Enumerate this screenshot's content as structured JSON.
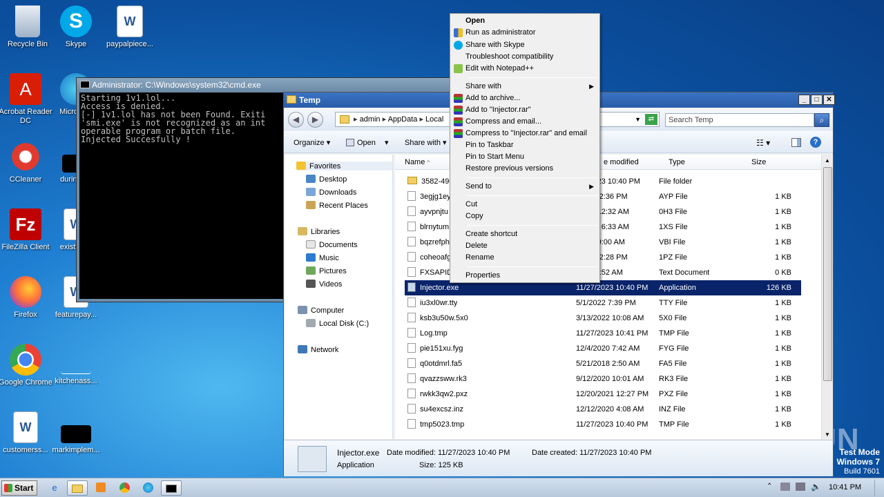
{
  "desktop": {
    "icons": [
      {
        "label": "Recycle Bin",
        "icon": "recycle-bin-icon"
      },
      {
        "label": "Skype",
        "icon": "skype-icon"
      },
      {
        "label": "paypalpiece...",
        "icon": "word-doc-icon"
      },
      {
        "label": "Acrobat Reader DC",
        "icon": "acrobat-icon"
      },
      {
        "label": "Microso...",
        "icon": "edge-icon"
      },
      {
        "label": "CCleaner",
        "icon": "ccleaner-icon"
      },
      {
        "label": "duringu...",
        "icon": "blank-file-icon"
      },
      {
        "label": "FileZilla Client",
        "icon": "filezilla-icon"
      },
      {
        "label": "existing...",
        "icon": "word-doc-icon"
      },
      {
        "label": "Firefox",
        "icon": "firefox-icon"
      },
      {
        "label": "featurepay...",
        "icon": "word-doc-icon"
      },
      {
        "label": "Google Chrome",
        "icon": "chrome-icon"
      },
      {
        "label": "kitchenass...",
        "icon": "blank-file-icon"
      },
      {
        "label": "customerss...",
        "icon": "word-doc-icon"
      },
      {
        "label": "markimplem...",
        "icon": "blank-file-icon"
      }
    ]
  },
  "cmd": {
    "title": "Administrator: C:\\Windows\\system32\\cmd.exe",
    "lines": "Starting 1v1.lol...\nAccess is denied.\n[-] 1v1.lol has not been Found. Exiti\n'smi.exe' is not recognized as an int\noperable program or batch file.\nInjected Succesfully !"
  },
  "explorer": {
    "title": "Temp",
    "address": [
      "admin",
      "AppData",
      "Local"
    ],
    "search_placeholder": "Search Temp",
    "toolbar": {
      "organize": "Organize",
      "open": "Open",
      "share_with": "Share with"
    },
    "nav": {
      "favorites": "Favorites",
      "desktop": "Desktop",
      "downloads": "Downloads",
      "recent": "Recent Places",
      "libraries": "Libraries",
      "documents": "Documents",
      "music": "Music",
      "pictures": "Pictures",
      "videos": "Videos",
      "computer": "Computer",
      "localdisk": "Local Disk (C:)",
      "network": "Network"
    },
    "columns": {
      "name": "Name",
      "modified": "e modified",
      "type": "Type",
      "size": "Size"
    },
    "rows": [
      {
        "name": "3582-490",
        "date": "/27/2023 10:40 PM",
        "type": "File folder",
        "size": ""
      },
      {
        "name": "3egjg1ey",
        "date": "2021 12:36 PM",
        "type": "AYP File",
        "size": "1 KB"
      },
      {
        "name": "ayvpnjtu",
        "date": "/2022 12:32 AM",
        "type": "0H3 File",
        "size": "1 KB"
      },
      {
        "name": "blrnytum",
        "date": "8/2017 6:33 AM",
        "type": "1XS File",
        "size": "1 KB"
      },
      {
        "name": "bqzrefph",
        "date": "/2023 9:00 AM",
        "type": "VBI File",
        "size": "1 KB"
      },
      {
        "name": "coheoafg",
        "date": "2020 12:28 PM",
        "type": "1PZ File",
        "size": "1 KB"
      },
      {
        "name": "FXSAPID",
        "date": "2018 9:52 AM",
        "type": "Text Document",
        "size": "0 KB"
      },
      {
        "name": "Injector.exe",
        "date": "11/27/2023 10:40 PM",
        "type": "Application",
        "size": "126 KB"
      },
      {
        "name": "iu3xl0wr.tty",
        "date": "5/1/2022 7:39 PM",
        "type": "TTY File",
        "size": "1 KB"
      },
      {
        "name": "ksb3u50w.5x0",
        "date": "3/13/2022 10:08 AM",
        "type": "5X0 File",
        "size": "1 KB"
      },
      {
        "name": "Log.tmp",
        "date": "11/27/2023 10:41 PM",
        "type": "TMP File",
        "size": "1 KB"
      },
      {
        "name": "pie151xu.fyg",
        "date": "12/4/2020 7:42 AM",
        "type": "FYG File",
        "size": "1 KB"
      },
      {
        "name": "q0otdmrl.fa5",
        "date": "5/21/2018 2:50 AM",
        "type": "FA5 File",
        "size": "1 KB"
      },
      {
        "name": "qvazzsww.rk3",
        "date": "9/12/2020 10:01 AM",
        "type": "RK3 File",
        "size": "1 KB"
      },
      {
        "name": "rwkk3qw2.pxz",
        "date": "12/20/2021 12:27 PM",
        "type": "PXZ File",
        "size": "1 KB"
      },
      {
        "name": "su4excsz.inz",
        "date": "12/12/2020 4:08 AM",
        "type": "INZ File",
        "size": "1 KB"
      },
      {
        "name": "tmp5023.tmp",
        "date": "11/27/2023 10:40 PM",
        "type": "TMP File",
        "size": "1 KB"
      }
    ],
    "details": {
      "filename": "Injector.exe",
      "type": "Application",
      "modified": "Date modified: 11/27/2023 10:40 PM",
      "created": "Date created: 11/27/2023 10:40 PM",
      "size": "Size: 125 KB"
    }
  },
  "context_menu": {
    "open": "Open",
    "run_admin": "Run as administrator",
    "share_skype": "Share with Skype",
    "troubleshoot": "Troubleshoot compatibility",
    "notepadpp": "Edit with Notepad++",
    "share_with": "Share with",
    "add_archive": "Add to archive...",
    "add_rar": "Add to \"Injector.rar\"",
    "compress_email": "Compress and email...",
    "compress_rar_email": "Compress to \"Injector.rar\" and email",
    "pin_taskbar": "Pin to Taskbar",
    "pin_start": "Pin to Start Menu",
    "restore": "Restore previous versions",
    "send_to": "Send to",
    "cut": "Cut",
    "copy": "Copy",
    "create_shortcut": "Create shortcut",
    "delete": "Delete",
    "rename": "Rename",
    "properties": "Properties"
  },
  "taskbar": {
    "start": "Start",
    "clock": "10:41 PM"
  },
  "watermark": "ANY RUN",
  "windows_info": {
    "line1": "Test Mode",
    "line2": "Windows 7",
    "line3": "Build 7601"
  }
}
